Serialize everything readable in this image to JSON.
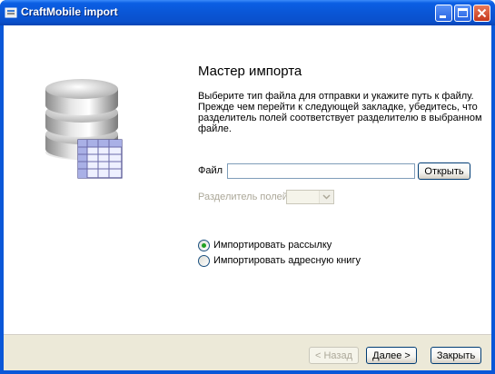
{
  "window": {
    "title": "CraftMobile import",
    "controls": [
      "minimize-icon",
      "maximize-icon",
      "close-icon"
    ]
  },
  "wizard": {
    "heading": "Мастер импорта",
    "description": "Выберите тип файла для отправки и укажите путь к файлу. Прежде чем перейти к следующей закладке, убедитесь, что разделитель полей соответствует разделителю в выбранном файле."
  },
  "file": {
    "label": "Файл",
    "value": "",
    "browse_label": "Открыть"
  },
  "separator": {
    "label": "Разделитель полей",
    "selected": ""
  },
  "import_type": {
    "options": [
      {
        "label": "Импортировать рассылку",
        "checked": true
      },
      {
        "label": "Импортировать адресную книгу",
        "checked": false
      }
    ]
  },
  "footer": {
    "back_label": "< Назад",
    "next_label": "Далее >",
    "close_label": "Закрыть"
  },
  "colors": {
    "titlebar": "#0a56d6",
    "radio_checked": "#21a121",
    "footer_bg": "#ece9d8"
  },
  "icons": {
    "illustration": "database-table-icon"
  }
}
